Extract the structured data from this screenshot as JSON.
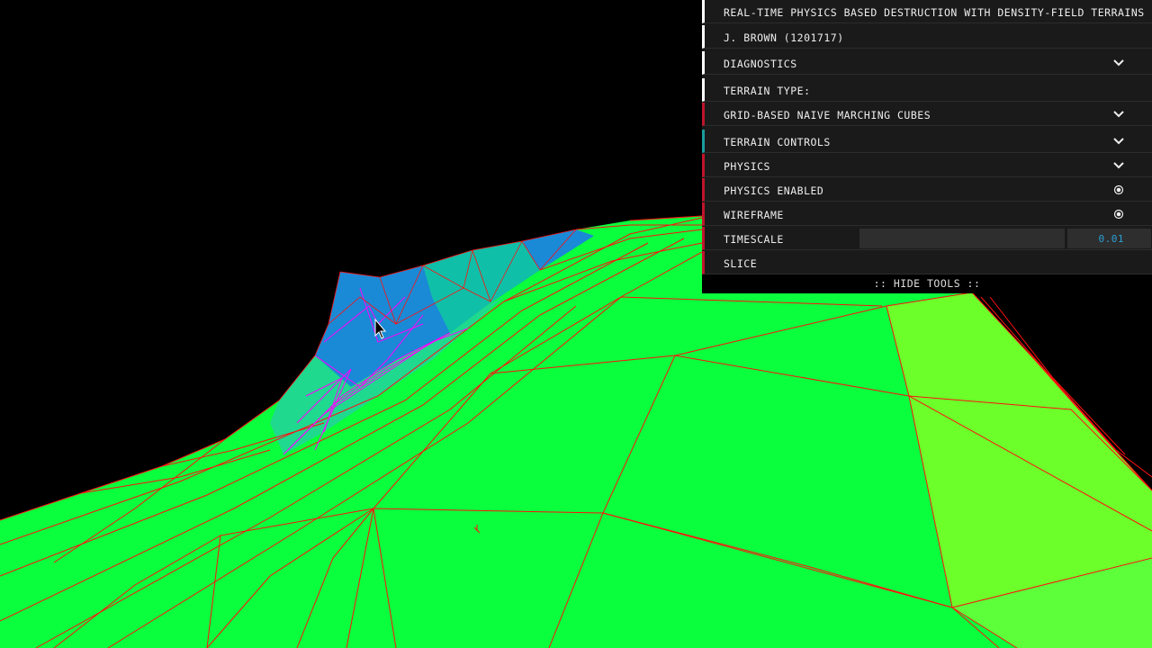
{
  "panel": {
    "title": "REAL-TIME PHYSICS BASED DESTRUCTION WITH DENSITY-FIELD TERRAINS",
    "author": "J. BROWN (1201717)",
    "diagnostics": "DIAGNOSTICS",
    "terrain_type_label": "TERRAIN TYPE:",
    "terrain_type_value": "GRID-BASED NAIVE MARCHING CUBES",
    "terrain_controls": "TERRAIN CONTROLS",
    "physics": "PHYSICS",
    "physics_enabled": "PHYSICS ENABLED",
    "wireframe": "WIREFRAME",
    "timescale": "TIMESCALE",
    "timescale_value": "0.01",
    "slice": "SLICE",
    "hide_tools": ":: HIDE TOOLS ::"
  },
  "colors": {
    "terrain_green": "#0aff3c",
    "terrain_yellowgreen": "#6cff2a",
    "wire_red": "#ff1010",
    "slice_magenta": "#ff00ff",
    "slice_blue": "#1a8ad6",
    "accent_red": "#c0152a",
    "accent_teal": "#1a9c9c"
  }
}
